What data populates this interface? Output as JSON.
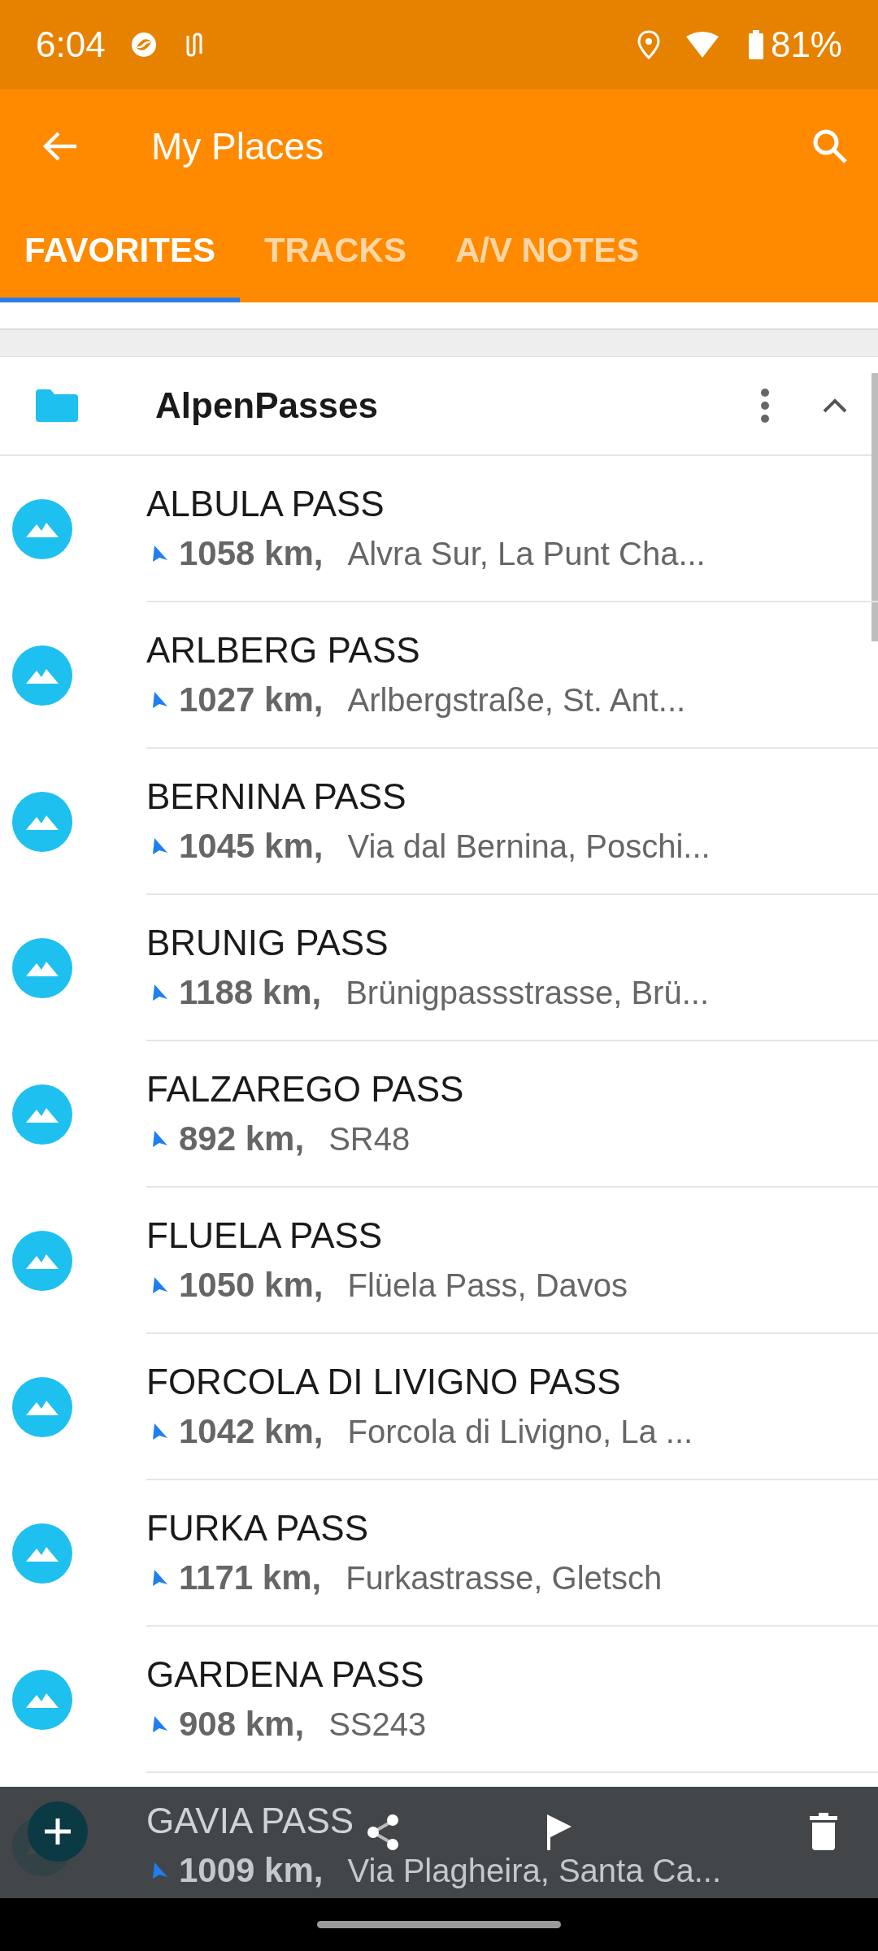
{
  "status_bar": {
    "time": "6:04",
    "battery": "81%"
  },
  "toolbar": {
    "title": "My Places"
  },
  "tabs": [
    {
      "label": "FAVORITES",
      "selected": true
    },
    {
      "label": "TRACKS",
      "selected": false
    },
    {
      "label": "A/V NOTES",
      "selected": false
    }
  ],
  "group": {
    "name": "AlpenPasses",
    "expanded": true
  },
  "places": [
    {
      "name": "ALBULA PASS",
      "distance": "1058 km,",
      "address": "Alvra Sur, La Punt Cha..."
    },
    {
      "name": "ARLBERG PASS",
      "distance": "1027 km,",
      "address": "Arlbergstraße, St. Ant..."
    },
    {
      "name": "BERNINA PASS",
      "distance": "1045 km,",
      "address": "Via dal Bernina, Poschi..."
    },
    {
      "name": "BRUNIG PASS",
      "distance": "1188 km,",
      "address": "Brünigpassstrasse, Brü..."
    },
    {
      "name": "FALZAREGO PASS",
      "distance": "892 km,",
      "address": "SR48"
    },
    {
      "name": "FLUELA PASS",
      "distance": "1050 km,",
      "address": "Flüela Pass, Davos"
    },
    {
      "name": "FORCOLA DI LIVIGNO PASS",
      "distance": "1042 km,",
      "address": "Forcola di Livigno, La ..."
    },
    {
      "name": "FURKA PASS",
      "distance": "1171 km,",
      "address": "Furkastrasse, Gletsch"
    },
    {
      "name": "GARDENA PASS",
      "distance": "908 km,",
      "address": "SS243"
    },
    {
      "name": "GAVIA PASS",
      "distance": "1009 km,",
      "address": "Via Plagheira, Santa Ca..."
    }
  ]
}
